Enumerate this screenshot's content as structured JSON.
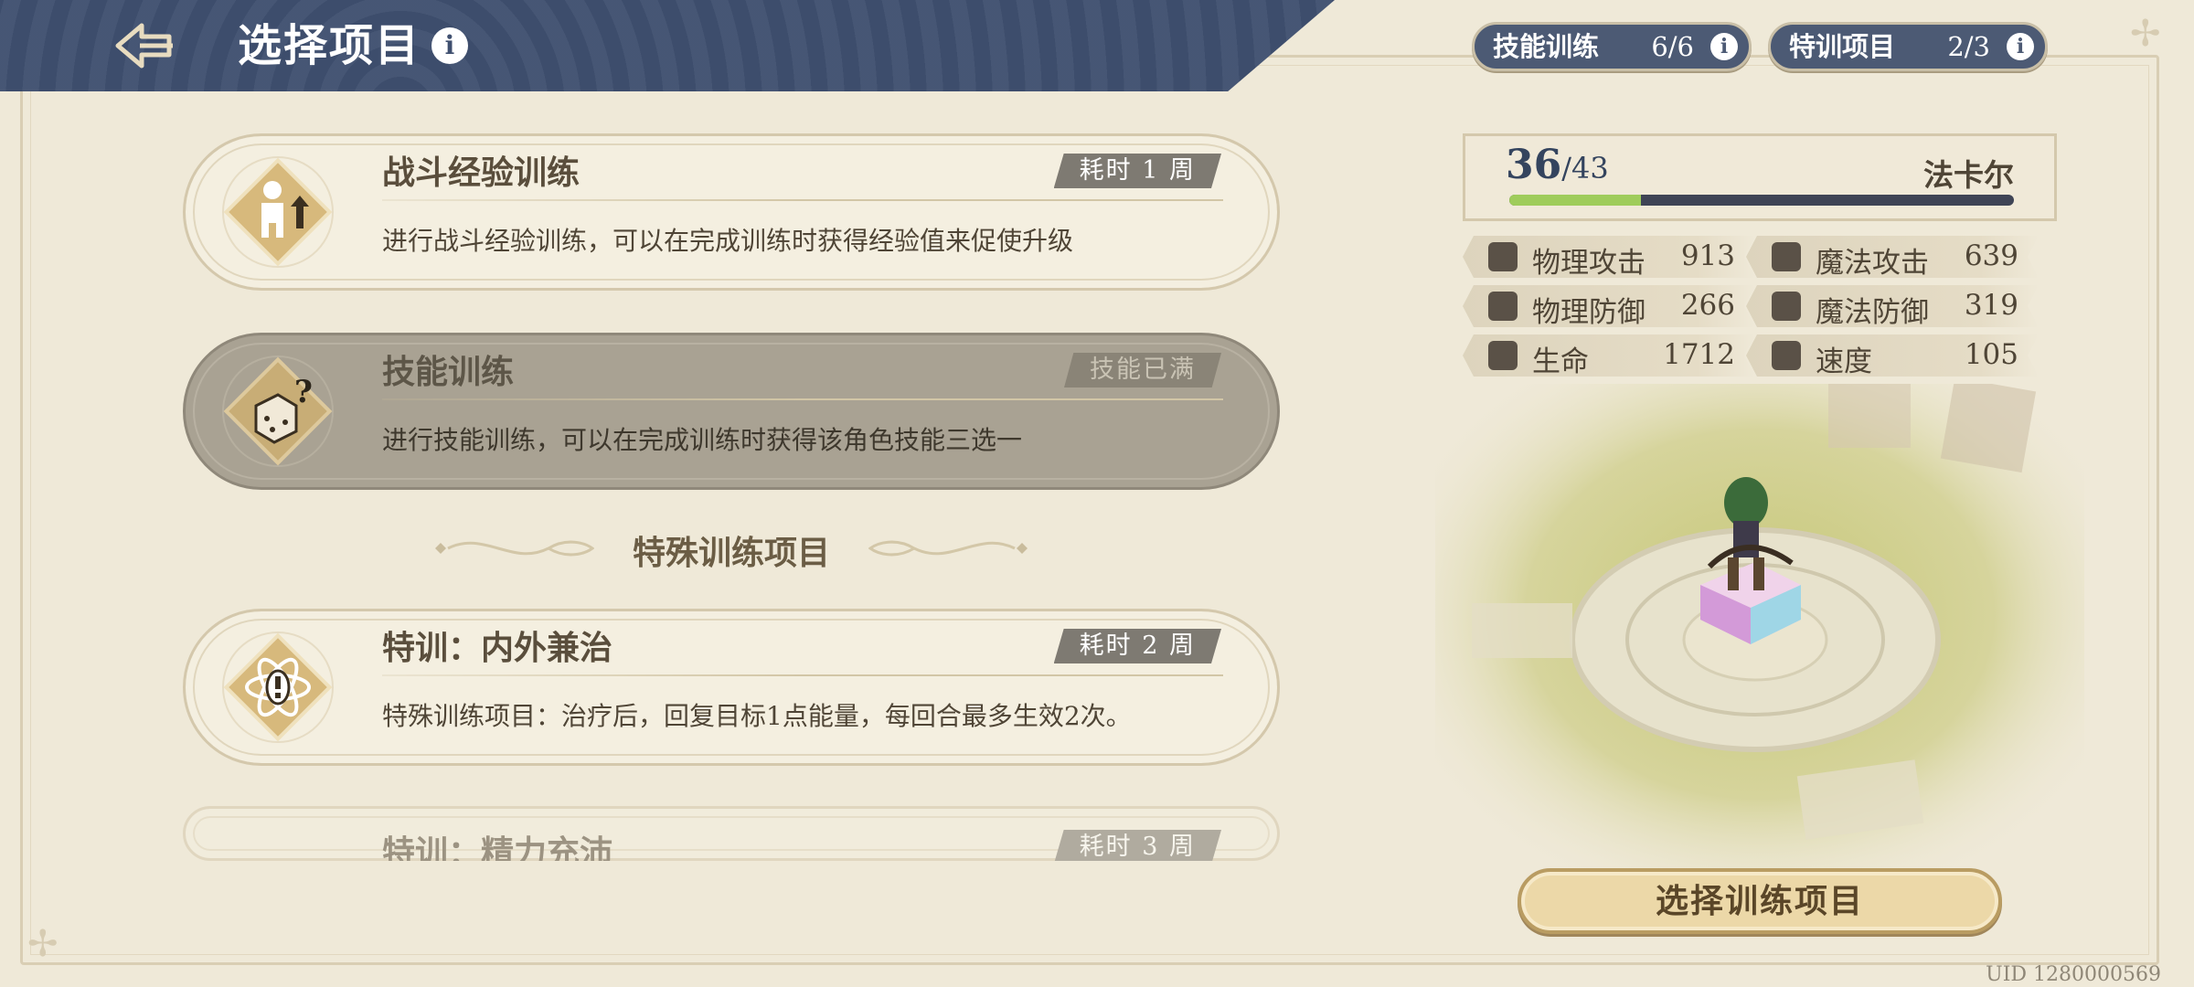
{
  "header": {
    "title": "选择项目",
    "info_glyph": "i"
  },
  "counters": [
    {
      "label": "技能训练",
      "value": "6/6"
    },
    {
      "label": "特训项目",
      "value": "2/3"
    }
  ],
  "trainings": [
    {
      "title": "战斗经验训练",
      "tag": "耗时 1 周",
      "desc": "进行战斗经验训练，可以在完成训练时获得经验值来促使升级",
      "icon": "level-up-icon",
      "state": "normal"
    },
    {
      "title": "技能训练",
      "tag": "技能已满",
      "desc": "进行技能训练，可以在完成训练时获得该角色技能三选一",
      "icon": "dice-question-icon",
      "state": "disabled"
    }
  ],
  "special_section": {
    "title": "特殊训练项目"
  },
  "special_trainings": [
    {
      "title": "特训：内外兼治",
      "tag": "耗时 2 周",
      "desc": "特殊训练项目：治疗后，回复目标1点能量，每回合最多生效2次。",
      "icon": "atom-exclamation-icon"
    },
    {
      "title": "特训：精力充沛",
      "tag": "耗时 3 周",
      "desc": ""
    }
  ],
  "character": {
    "name": "法卡尔",
    "level": "36",
    "max_level": "/43",
    "level_progress": 0.26
  },
  "stats": [
    {
      "label": "物理攻击",
      "value": "913",
      "icon": "sword-icon"
    },
    {
      "label": "魔法攻击",
      "value": "639",
      "icon": "wand-icon"
    },
    {
      "label": "物理防御",
      "value": "266",
      "icon": "shield-icon"
    },
    {
      "label": "魔法防御",
      "value": "319",
      "icon": "wizard-hat-icon"
    },
    {
      "label": "生命",
      "value": "1712",
      "icon": "heart-icon"
    },
    {
      "label": "速度",
      "value": "105",
      "icon": "wing-icon"
    }
  ],
  "confirm_button": "选择训练项目",
  "uid": "UID 1280000569",
  "colors": {
    "header": "#3f4f6f",
    "background": "#efe9d8",
    "button": "#ecd8a8",
    "level_fill": "#9fcc5b"
  }
}
